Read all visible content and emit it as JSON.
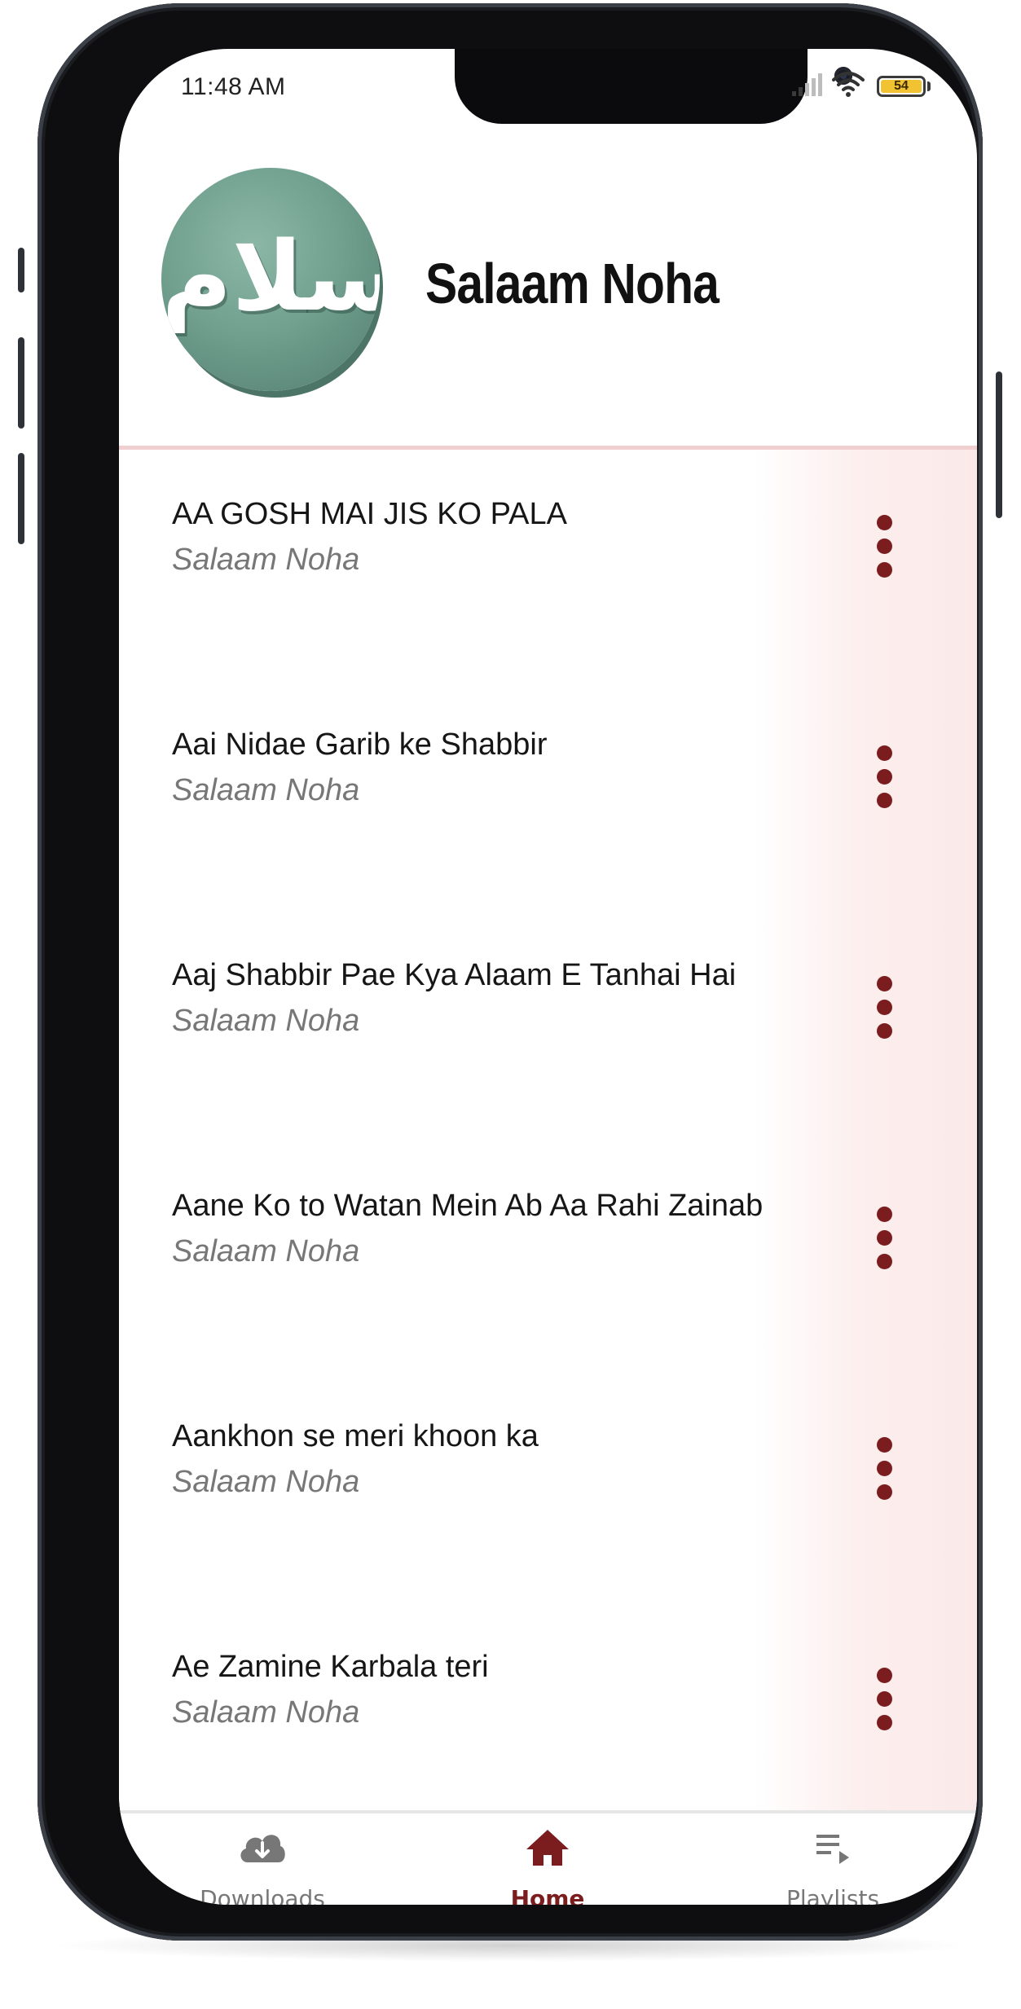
{
  "status_bar": {
    "time": "11:48 AM",
    "battery_level": "54"
  },
  "header": {
    "app_title": "Salaam Noha",
    "logo_text": "سلام"
  },
  "songs": [
    {
      "title": "AA GOSH MAI JIS KO PALA",
      "subtitle": "Salaam Noha"
    },
    {
      "title": "Aai Nidae Garib ke Shabbir",
      "subtitle": "Salaam Noha"
    },
    {
      "title": "Aaj Shabbir Pae Kya Alaam E Tanhai Hai",
      "subtitle": "Salaam Noha"
    },
    {
      "title": "Aane Ko to Watan Mein Ab Aa Rahi Zainab",
      "subtitle": "Salaam Noha"
    },
    {
      "title": "Aankhon se meri khoon ka",
      "subtitle": "Salaam Noha"
    },
    {
      "title": "Ae Zamine Karbala teri",
      "subtitle": "Salaam Noha"
    }
  ],
  "bottom_nav": {
    "downloads": {
      "label": "Downloads",
      "icon": "cloud-download-icon"
    },
    "home": {
      "label": "Home",
      "icon": "home-icon",
      "active": true
    },
    "playlists": {
      "label": "Playlists",
      "icon": "playlist-play-icon"
    }
  },
  "colors": {
    "accent": "#7b1d1f",
    "inactive": "#777777",
    "logo_green": "#72a190",
    "divider": "#f1cfd0"
  }
}
